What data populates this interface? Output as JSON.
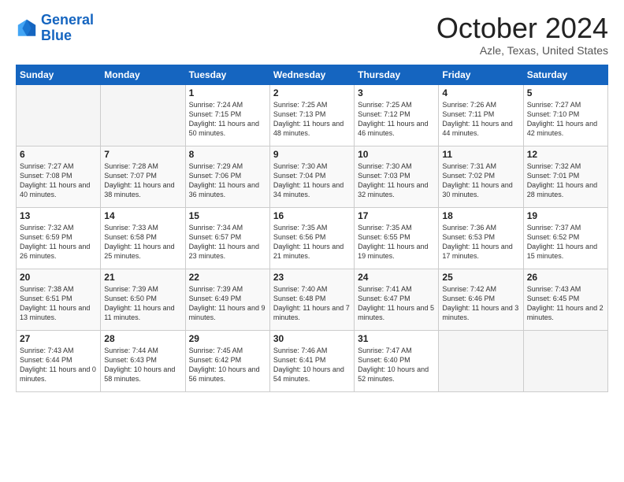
{
  "header": {
    "logo_line1": "General",
    "logo_line2": "Blue",
    "month": "October 2024",
    "location": "Azle, Texas, United States"
  },
  "weekdays": [
    "Sunday",
    "Monday",
    "Tuesday",
    "Wednesday",
    "Thursday",
    "Friday",
    "Saturday"
  ],
  "weeks": [
    [
      {
        "day": "",
        "empty": true
      },
      {
        "day": "",
        "empty": true
      },
      {
        "day": "1",
        "sunrise": "Sunrise: 7:24 AM",
        "sunset": "Sunset: 7:15 PM",
        "daylight": "Daylight: 11 hours and 50 minutes."
      },
      {
        "day": "2",
        "sunrise": "Sunrise: 7:25 AM",
        "sunset": "Sunset: 7:13 PM",
        "daylight": "Daylight: 11 hours and 48 minutes."
      },
      {
        "day": "3",
        "sunrise": "Sunrise: 7:25 AM",
        "sunset": "Sunset: 7:12 PM",
        "daylight": "Daylight: 11 hours and 46 minutes."
      },
      {
        "day": "4",
        "sunrise": "Sunrise: 7:26 AM",
        "sunset": "Sunset: 7:11 PM",
        "daylight": "Daylight: 11 hours and 44 minutes."
      },
      {
        "day": "5",
        "sunrise": "Sunrise: 7:27 AM",
        "sunset": "Sunset: 7:10 PM",
        "daylight": "Daylight: 11 hours and 42 minutes."
      }
    ],
    [
      {
        "day": "6",
        "sunrise": "Sunrise: 7:27 AM",
        "sunset": "Sunset: 7:08 PM",
        "daylight": "Daylight: 11 hours and 40 minutes."
      },
      {
        "day": "7",
        "sunrise": "Sunrise: 7:28 AM",
        "sunset": "Sunset: 7:07 PM",
        "daylight": "Daylight: 11 hours and 38 minutes."
      },
      {
        "day": "8",
        "sunrise": "Sunrise: 7:29 AM",
        "sunset": "Sunset: 7:06 PM",
        "daylight": "Daylight: 11 hours and 36 minutes."
      },
      {
        "day": "9",
        "sunrise": "Sunrise: 7:30 AM",
        "sunset": "Sunset: 7:04 PM",
        "daylight": "Daylight: 11 hours and 34 minutes."
      },
      {
        "day": "10",
        "sunrise": "Sunrise: 7:30 AM",
        "sunset": "Sunset: 7:03 PM",
        "daylight": "Daylight: 11 hours and 32 minutes."
      },
      {
        "day": "11",
        "sunrise": "Sunrise: 7:31 AM",
        "sunset": "Sunset: 7:02 PM",
        "daylight": "Daylight: 11 hours and 30 minutes."
      },
      {
        "day": "12",
        "sunrise": "Sunrise: 7:32 AM",
        "sunset": "Sunset: 7:01 PM",
        "daylight": "Daylight: 11 hours and 28 minutes."
      }
    ],
    [
      {
        "day": "13",
        "sunrise": "Sunrise: 7:32 AM",
        "sunset": "Sunset: 6:59 PM",
        "daylight": "Daylight: 11 hours and 26 minutes."
      },
      {
        "day": "14",
        "sunrise": "Sunrise: 7:33 AM",
        "sunset": "Sunset: 6:58 PM",
        "daylight": "Daylight: 11 hours and 25 minutes."
      },
      {
        "day": "15",
        "sunrise": "Sunrise: 7:34 AM",
        "sunset": "Sunset: 6:57 PM",
        "daylight": "Daylight: 11 hours and 23 minutes."
      },
      {
        "day": "16",
        "sunrise": "Sunrise: 7:35 AM",
        "sunset": "Sunset: 6:56 PM",
        "daylight": "Daylight: 11 hours and 21 minutes."
      },
      {
        "day": "17",
        "sunrise": "Sunrise: 7:35 AM",
        "sunset": "Sunset: 6:55 PM",
        "daylight": "Daylight: 11 hours and 19 minutes."
      },
      {
        "day": "18",
        "sunrise": "Sunrise: 7:36 AM",
        "sunset": "Sunset: 6:53 PM",
        "daylight": "Daylight: 11 hours and 17 minutes."
      },
      {
        "day": "19",
        "sunrise": "Sunrise: 7:37 AM",
        "sunset": "Sunset: 6:52 PM",
        "daylight": "Daylight: 11 hours and 15 minutes."
      }
    ],
    [
      {
        "day": "20",
        "sunrise": "Sunrise: 7:38 AM",
        "sunset": "Sunset: 6:51 PM",
        "daylight": "Daylight: 11 hours and 13 minutes."
      },
      {
        "day": "21",
        "sunrise": "Sunrise: 7:39 AM",
        "sunset": "Sunset: 6:50 PM",
        "daylight": "Daylight: 11 hours and 11 minutes."
      },
      {
        "day": "22",
        "sunrise": "Sunrise: 7:39 AM",
        "sunset": "Sunset: 6:49 PM",
        "daylight": "Daylight: 11 hours and 9 minutes."
      },
      {
        "day": "23",
        "sunrise": "Sunrise: 7:40 AM",
        "sunset": "Sunset: 6:48 PM",
        "daylight": "Daylight: 11 hours and 7 minutes."
      },
      {
        "day": "24",
        "sunrise": "Sunrise: 7:41 AM",
        "sunset": "Sunset: 6:47 PM",
        "daylight": "Daylight: 11 hours and 5 minutes."
      },
      {
        "day": "25",
        "sunrise": "Sunrise: 7:42 AM",
        "sunset": "Sunset: 6:46 PM",
        "daylight": "Daylight: 11 hours and 3 minutes."
      },
      {
        "day": "26",
        "sunrise": "Sunrise: 7:43 AM",
        "sunset": "Sunset: 6:45 PM",
        "daylight": "Daylight: 11 hours and 2 minutes."
      }
    ],
    [
      {
        "day": "27",
        "sunrise": "Sunrise: 7:43 AM",
        "sunset": "Sunset: 6:44 PM",
        "daylight": "Daylight: 11 hours and 0 minutes."
      },
      {
        "day": "28",
        "sunrise": "Sunrise: 7:44 AM",
        "sunset": "Sunset: 6:43 PM",
        "daylight": "Daylight: 10 hours and 58 minutes."
      },
      {
        "day": "29",
        "sunrise": "Sunrise: 7:45 AM",
        "sunset": "Sunset: 6:42 PM",
        "daylight": "Daylight: 10 hours and 56 minutes."
      },
      {
        "day": "30",
        "sunrise": "Sunrise: 7:46 AM",
        "sunset": "Sunset: 6:41 PM",
        "daylight": "Daylight: 10 hours and 54 minutes."
      },
      {
        "day": "31",
        "sunrise": "Sunrise: 7:47 AM",
        "sunset": "Sunset: 6:40 PM",
        "daylight": "Daylight: 10 hours and 52 minutes."
      },
      {
        "day": "",
        "empty": true
      },
      {
        "day": "",
        "empty": true
      }
    ]
  ]
}
